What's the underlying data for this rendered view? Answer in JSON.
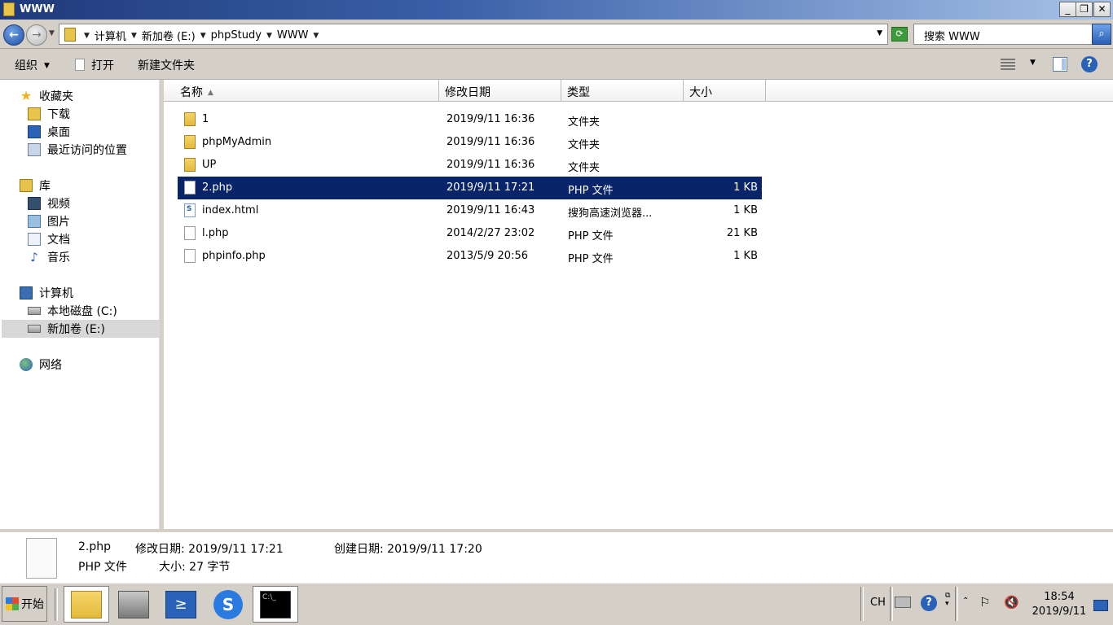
{
  "window": {
    "title": "WWW"
  },
  "address": {
    "crumbs": [
      "计算机",
      "新加卷 (E:)",
      "phpStudy",
      "WWW"
    ],
    "search_placeholder": "搜索 WWW"
  },
  "toolbar": {
    "organize": "组织",
    "open": "打开",
    "new_folder": "新建文件夹"
  },
  "nav": {
    "favorites": "收藏夹",
    "downloads": "下载",
    "desktop": "桌面",
    "recent": "最近访问的位置",
    "libraries": "库",
    "videos": "视频",
    "pictures": "图片",
    "documents": "文档",
    "music": "音乐",
    "computer": "计算机",
    "drive_c": "本地磁盘 (C:)",
    "drive_e": "新加卷 (E:)",
    "network": "网络"
  },
  "columns": {
    "name": "名称",
    "modified": "修改日期",
    "type": "类型",
    "size": "大小"
  },
  "files": [
    {
      "name": "1",
      "modified": "2019/9/11 16:36",
      "type": "文件夹",
      "size": ""
    },
    {
      "name": "phpMyAdmin",
      "modified": "2019/9/11 16:36",
      "type": "文件夹",
      "size": ""
    },
    {
      "name": "UP",
      "modified": "2019/9/11 16:36",
      "type": "文件夹",
      "size": ""
    },
    {
      "name": "2.php",
      "modified": "2019/9/11 17:21",
      "type": "PHP 文件",
      "size": "1 KB"
    },
    {
      "name": "index.html",
      "modified": "2019/9/11 16:43",
      "type": "搜狗高速浏览器...",
      "size": "1 KB"
    },
    {
      "name": "l.php",
      "modified": "2014/2/27 23:02",
      "type": "PHP 文件",
      "size": "21 KB"
    },
    {
      "name": "phpinfo.php",
      "modified": "2013/5/9 20:56",
      "type": "PHP 文件",
      "size": "1 KB"
    }
  ],
  "details": {
    "filename": "2.php",
    "modified": "修改日期: 2019/9/11 17:21",
    "created": "创建日期: 2019/9/11 17:20",
    "type": "PHP 文件",
    "size": "大小: 27 字节"
  },
  "taskbar": {
    "start": "开始",
    "lang": "CH",
    "time": "18:54",
    "date": "2019/9/11"
  },
  "colors": {
    "selection": "#0a246a",
    "chrome": "#d4d0c8"
  }
}
